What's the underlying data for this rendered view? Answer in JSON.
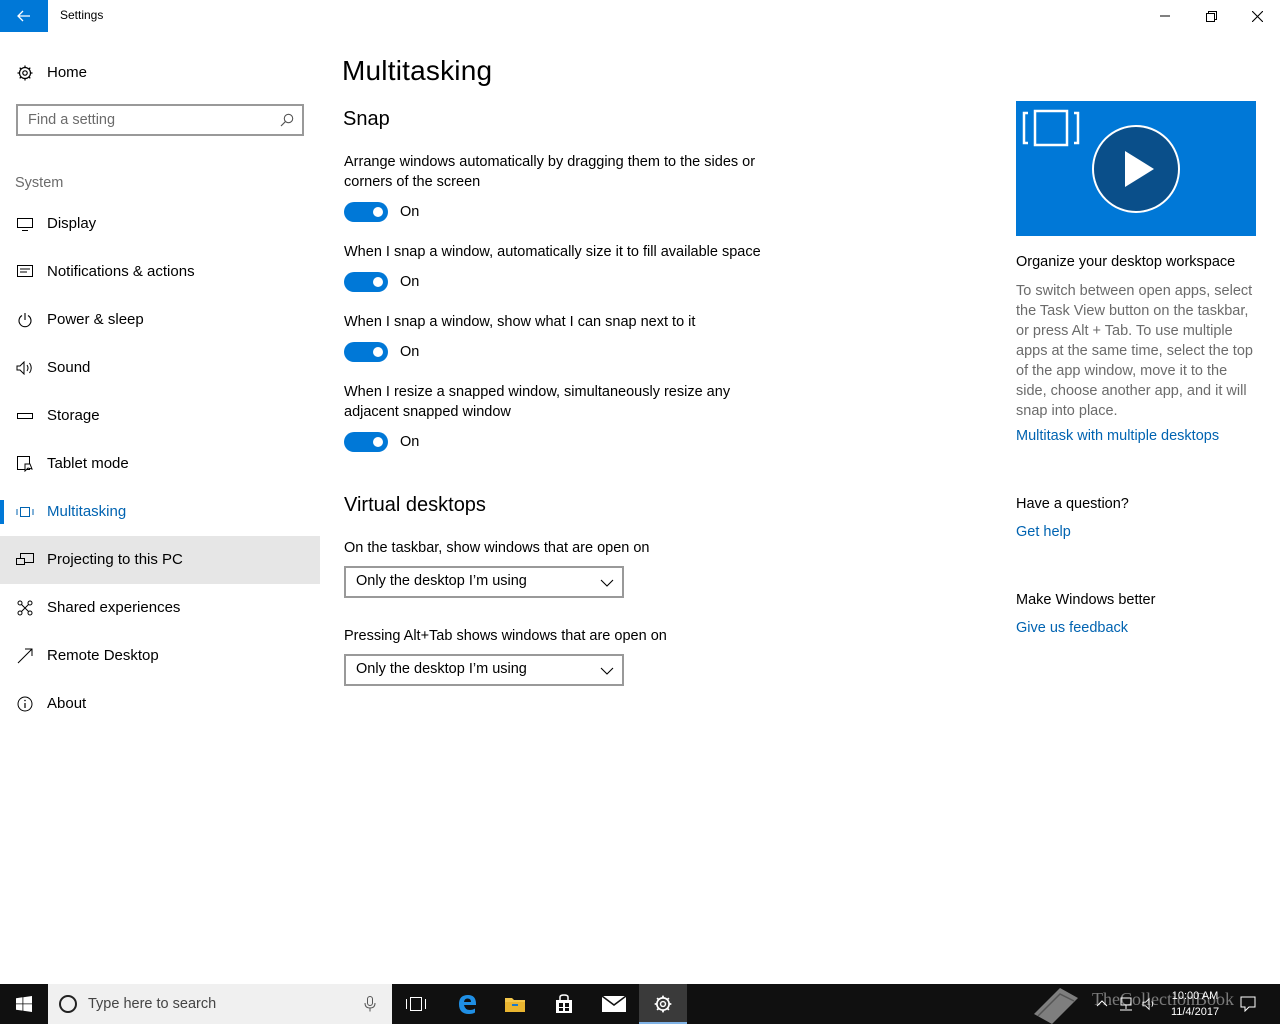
{
  "window": {
    "title": "Settings"
  },
  "sidebar": {
    "home_label": "Home",
    "search_placeholder": "Find a setting",
    "section_label": "System",
    "items": [
      {
        "label": "Display",
        "icon": "display-icon"
      },
      {
        "label": "Notifications & actions",
        "icon": "notifications-icon"
      },
      {
        "label": "Power & sleep",
        "icon": "power-icon"
      },
      {
        "label": "Sound",
        "icon": "sound-icon"
      },
      {
        "label": "Storage",
        "icon": "storage-icon"
      },
      {
        "label": "Tablet mode",
        "icon": "tablet-mode-icon"
      },
      {
        "label": "Multitasking",
        "icon": "multitasking-icon",
        "selected": true
      },
      {
        "label": "Projecting to this PC",
        "icon": "projecting-icon",
        "hovered": true
      },
      {
        "label": "Shared experiences",
        "icon": "shared-experiences-icon"
      },
      {
        "label": "Remote Desktop",
        "icon": "remote-desktop-icon"
      },
      {
        "label": "About",
        "icon": "info-icon"
      }
    ]
  },
  "main": {
    "title": "Multitasking",
    "snap": {
      "heading": "Snap",
      "options": [
        {
          "text": "Arrange windows automatically by dragging them to the sides or corners of the screen",
          "state": "On"
        },
        {
          "text": "When I snap a window, automatically size it to fill available space",
          "state": "On"
        },
        {
          "text": "When I snap a window, show what I can snap next to it",
          "state": "On"
        },
        {
          "text": "When I resize a snapped window, simultaneously resize any adjacent snapped window",
          "state": "On"
        }
      ]
    },
    "virtual_desktops": {
      "heading": "Virtual desktops",
      "taskbar_label": "On the taskbar, show windows that are open on",
      "taskbar_value": "Only the desktop I’m using",
      "alttab_label": "Pressing Alt+Tab shows windows that are open on",
      "alttab_value": "Only the desktop I’m using"
    }
  },
  "right_panel": {
    "video_heading": "Organize your desktop workspace",
    "video_desc": "To switch between open apps, select the Task View button on the taskbar, or press Alt + Tab. To use multiple apps at the same time, select the top of the app window, move it to the side, choose another app, and it will snap into place.",
    "video_link": "Multitask with multiple desktops",
    "question_heading": "Have a question?",
    "help_link": "Get help",
    "better_heading": "Make Windows better",
    "feedback_link": "Give us feedback"
  },
  "taskbar": {
    "search_placeholder": "Type here to search",
    "time": "10:00 AM",
    "date": "11/4/2017",
    "watermark": "TheCollectionBook"
  },
  "colors": {
    "accent": "#0078d7",
    "link": "#0063b1",
    "muted": "#6b6b6b"
  }
}
